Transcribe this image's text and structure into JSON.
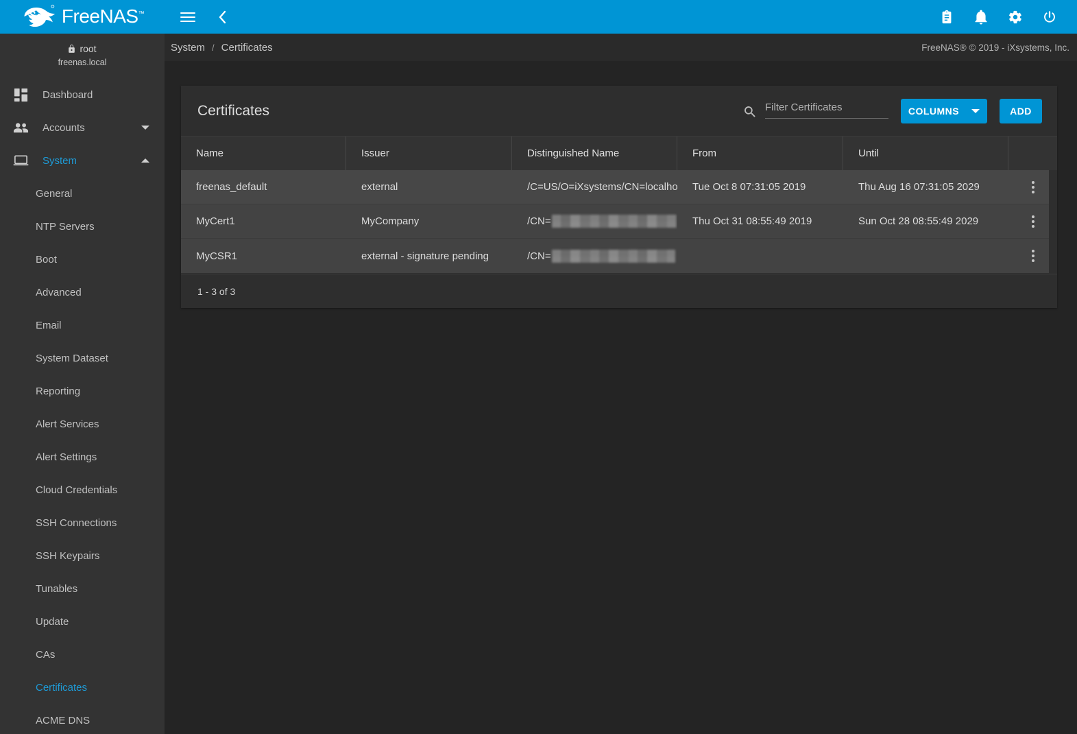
{
  "brand": {
    "name": "FreeNAS",
    "trademark": "™",
    "logo_icon": "freenas-fish-logo"
  },
  "topbar": {
    "menu_icon": "hamburger-menu-icon",
    "back_icon": "chevron-left-icon",
    "right_icons": [
      {
        "name": "tasks-clipboard-icon",
        "glyph": "clipboard"
      },
      {
        "name": "notifications-bell-icon",
        "glyph": "bell"
      },
      {
        "name": "settings-gear-icon",
        "glyph": "gear"
      },
      {
        "name": "power-icon",
        "glyph": "power"
      }
    ]
  },
  "sidebar": {
    "user": {
      "lock_icon": "lock-icon",
      "username": "root",
      "hostname": "freenas.local"
    },
    "items": [
      {
        "label": "Dashboard",
        "icon": "dashboard-grid-icon",
        "active": false,
        "expandable": false
      },
      {
        "label": "Accounts",
        "icon": "people-icon",
        "active": false,
        "expandable": true,
        "expanded": false
      },
      {
        "label": "System",
        "icon": "laptop-icon",
        "active": true,
        "expandable": true,
        "expanded": true
      }
    ],
    "system_children": [
      {
        "label": "General",
        "active": false
      },
      {
        "label": "NTP Servers",
        "active": false
      },
      {
        "label": "Boot",
        "active": false
      },
      {
        "label": "Advanced",
        "active": false
      },
      {
        "label": "Email",
        "active": false
      },
      {
        "label": "System Dataset",
        "active": false
      },
      {
        "label": "Reporting",
        "active": false
      },
      {
        "label": "Alert Services",
        "active": false
      },
      {
        "label": "Alert Settings",
        "active": false
      },
      {
        "label": "Cloud Credentials",
        "active": false
      },
      {
        "label": "SSH Connections",
        "active": false
      },
      {
        "label": "SSH Keypairs",
        "active": false
      },
      {
        "label": "Tunables",
        "active": false
      },
      {
        "label": "Update",
        "active": false
      },
      {
        "label": "CAs",
        "active": false
      },
      {
        "label": "Certificates",
        "active": true
      },
      {
        "label": "ACME DNS",
        "active": false
      }
    ]
  },
  "breadcrumb": {
    "root": "System",
    "separator": "/",
    "current": "Certificates"
  },
  "footer_note": "FreeNAS® © 2019 - iXsystems, Inc.",
  "card": {
    "title": "Certificates",
    "search": {
      "icon": "search-icon",
      "placeholder": "Filter Certificates",
      "value": ""
    },
    "columns_button": "COLUMNS",
    "add_button": "ADD"
  },
  "table": {
    "headers": [
      "Name",
      "Issuer",
      "Distinguished Name",
      "From",
      "Until"
    ],
    "rows": [
      {
        "name": "freenas_default",
        "issuer": "external",
        "distinguished_name": "/C=US/O=iXsystems/CN=localho",
        "dn_redacted": false,
        "from": "Tue Oct 8 07:31:05 2019",
        "until": "Thu Aug 16 07:31:05 2029",
        "hovered": true,
        "menu_icon": "row-menu-icon"
      },
      {
        "name": "MyCert1",
        "issuer": "MyCompany",
        "distinguished_name": "/CN=",
        "dn_redacted": true,
        "dn_redacted_width": 182,
        "from": "Thu Oct 31 08:55:49 2019",
        "until": "Sun Oct 28 08:55:49 2029",
        "hovered": false,
        "menu_icon": "row-menu-icon"
      },
      {
        "name": "MyCSR1",
        "issuer": "external - signature pending",
        "distinguished_name": "/CN=",
        "dn_redacted": true,
        "dn_redacted_width": 180,
        "from": "",
        "until": "",
        "hovered": false,
        "menu_icon": "row-menu-icon"
      }
    ],
    "pagination": "1 - 3 of 3"
  },
  "colors": {
    "accent": "#0095d5",
    "active_link": "#1e9bd7",
    "page_bg": "#242424",
    "sidebar_bg": "#333333",
    "card_bg": "#2e2e2e",
    "row_bg": "#434343",
    "row_hover_bg": "#474747"
  }
}
